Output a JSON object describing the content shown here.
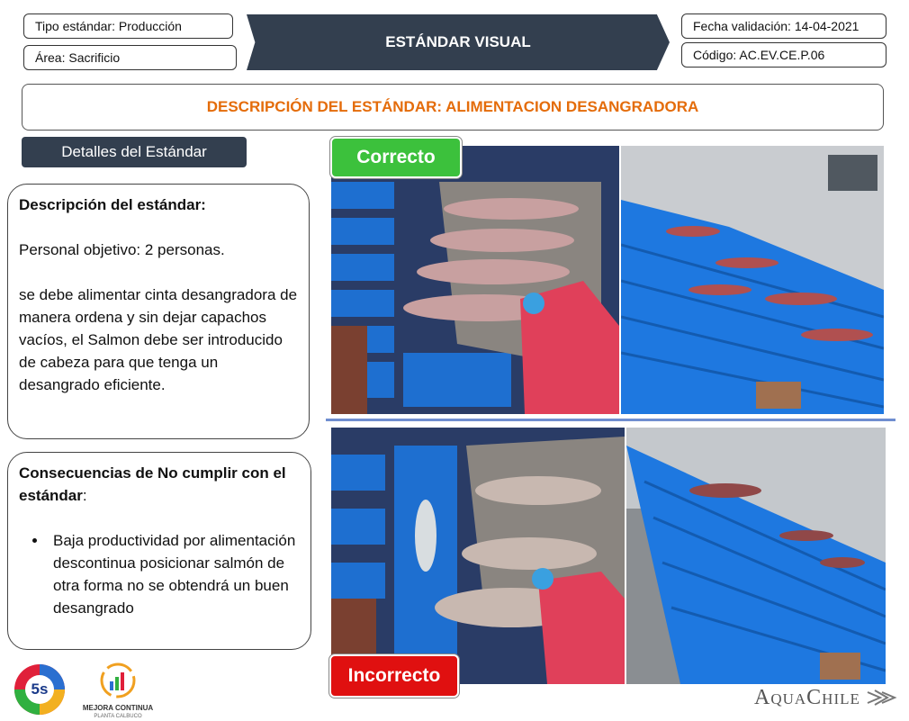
{
  "header": {
    "tipo_estandar": "Tipo estándar: Producción",
    "area": "Área: Sacrificio",
    "banner": "ESTÁNDAR VISUAL",
    "fecha_validacion": "Fecha validación: 14-04-2021",
    "codigo": "Código: AC.EV.CE.P.06"
  },
  "title": "DESCRIPCIÓN DEL ESTÁNDAR: ALIMENTACION DESANGRADORA",
  "details_label": "Detalles del Estándar",
  "description": {
    "heading": "Descripción del estándar:",
    "personal": "Personal objetivo: 2 personas.",
    "body": "se debe alimentar cinta desangradora de manera ordena y sin dejar capachos vacíos, el Salmon debe ser introducido de cabeza para que tenga un desangrado eficiente."
  },
  "consequences": {
    "heading": "Consecuencias de No cumplir con el estándar",
    "heading_suffix": ":",
    "items": [
      "Baja productividad por alimentación descontinua posicionar salmón de otra forma no se obtendrá un buen desangrado"
    ]
  },
  "badges": {
    "correct": "Correcto",
    "incorrect": "Incorrecto"
  },
  "logos": {
    "five_s": "5s",
    "mejora_title": "MEJORA CONTINUA",
    "mejora_sub": "PLANTA CALBUCO",
    "aquachile": "AquaChile"
  },
  "colors": {
    "banner": "#333f4f",
    "title_text": "#e46c0a",
    "correct": "#3cc13c",
    "incorrect": "#e01010",
    "divider": "#6f8ed0"
  }
}
